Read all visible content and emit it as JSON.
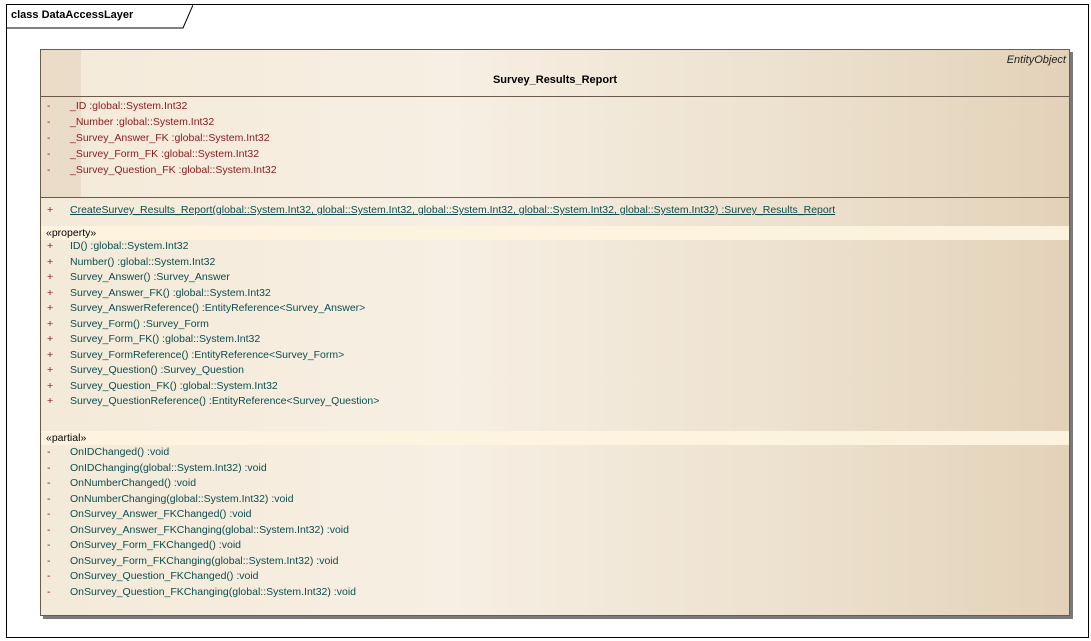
{
  "frame": {
    "title": "class DataAccessLayer"
  },
  "class": {
    "stereotype": "EntityObject",
    "name": "Survey_Results_Report",
    "attributes": [
      {
        "vis": "-",
        "text": "_ID  :global::System.Int32"
      },
      {
        "vis": "-",
        "text": "_Number  :global::System.Int32"
      },
      {
        "vis": "-",
        "text": "_Survey_Answer_FK  :global::System.Int32"
      },
      {
        "vis": "-",
        "text": "_Survey_Form_FK  :global::System.Int32"
      },
      {
        "vis": "-",
        "text": "_Survey_Question_FK  :global::System.Int32"
      }
    ],
    "static_ops": [
      {
        "vis": "+",
        "text": "CreateSurvey_Results_Report(global::System.Int32, global::System.Int32, global::System.Int32, global::System.Int32, global::System.Int32)  :Survey_Results_Report"
      }
    ],
    "property_stereotype": "«property»",
    "properties": [
      {
        "vis": "+",
        "text": "ID()  :global::System.Int32"
      },
      {
        "vis": "+",
        "text": "Number()  :global::System.Int32"
      },
      {
        "vis": "+",
        "text": "Survey_Answer()  :Survey_Answer"
      },
      {
        "vis": "+",
        "text": "Survey_Answer_FK()  :global::System.Int32"
      },
      {
        "vis": "+",
        "text": "Survey_AnswerReference()  :EntityReference<Survey_Answer>"
      },
      {
        "vis": "+",
        "text": "Survey_Form()  :Survey_Form"
      },
      {
        "vis": "+",
        "text": "Survey_Form_FK()  :global::System.Int32"
      },
      {
        "vis": "+",
        "text": "Survey_FormReference()  :EntityReference<Survey_Form>"
      },
      {
        "vis": "+",
        "text": "Survey_Question()  :Survey_Question"
      },
      {
        "vis": "+",
        "text": "Survey_Question_FK()  :global::System.Int32"
      },
      {
        "vis": "+",
        "text": "Survey_QuestionReference()  :EntityReference<Survey_Question>"
      }
    ],
    "partial_stereotype": "«partial»",
    "partials": [
      {
        "vis": "-",
        "text": "OnIDChanged()  :void"
      },
      {
        "vis": "-",
        "text": "OnIDChanging(global::System.Int32)  :void"
      },
      {
        "vis": "-",
        "text": "OnNumberChanged()  :void"
      },
      {
        "vis": "-",
        "text": "OnNumberChanging(global::System.Int32)  :void"
      },
      {
        "vis": "-",
        "text": "OnSurvey_Answer_FKChanged()  :void"
      },
      {
        "vis": "-",
        "text": "OnSurvey_Answer_FKChanging(global::System.Int32)  :void"
      },
      {
        "vis": "-",
        "text": "OnSurvey_Form_FKChanged()  :void"
      },
      {
        "vis": "-",
        "text": "OnSurvey_Form_FKChanging(global::System.Int32)  :void"
      },
      {
        "vis": "-",
        "text": "OnSurvey_Question_FKChanged()  :void"
      },
      {
        "vis": "-",
        "text": "OnSurvey_Question_FKChanging(global::System.Int32)  :void"
      }
    ]
  }
}
